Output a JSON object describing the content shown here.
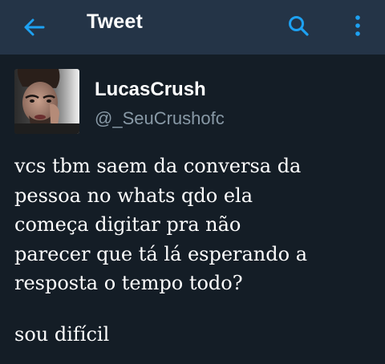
{
  "topbar": {
    "title": "Tweet",
    "back_icon": "arrow-left-icon",
    "search_icon": "search-icon",
    "more_icon": "more-vertical-icon",
    "bar_color": "#243447",
    "accent_color": "#1da1f2"
  },
  "tweet": {
    "author": {
      "display_name": "LucasCrush",
      "handle": "@_SeuCrushofc"
    },
    "text": "vcs tbm saem da conversa da\npessoa no whats qdo ela\ncomeça digitar pra não\nparecer que tá lá esperando a\nresposta o tempo todo?",
    "extra": "sou difícil"
  },
  "theme": {
    "background": "#141d26",
    "text": "#ffffff",
    "muted": "#8899a6"
  }
}
